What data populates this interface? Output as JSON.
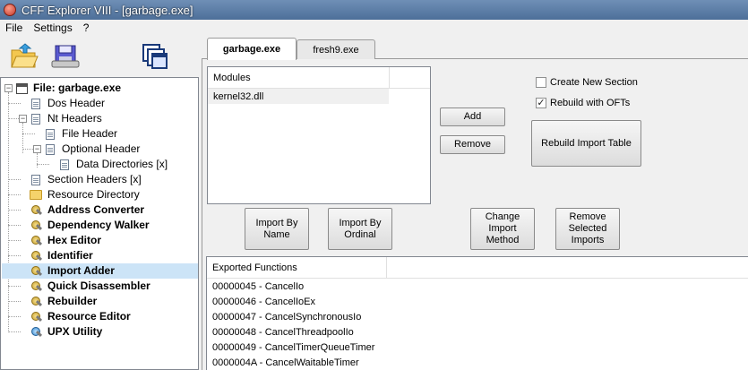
{
  "window": {
    "title": "CFF Explorer VIII - [garbage.exe]"
  },
  "menu": [
    "File",
    "Settings",
    "?"
  ],
  "toolbar": {
    "open_icon": "open-folder-icon",
    "save_icon": "save-disk-icon",
    "windows_icon": "windows-icon"
  },
  "tree": {
    "root": "File: garbage.exe",
    "items": [
      {
        "label": "Dos Header"
      },
      {
        "label": "Nt Headers"
      },
      {
        "label": "File Header"
      },
      {
        "label": "Optional Header"
      },
      {
        "label": "Data Directories [x]"
      },
      {
        "label": "Section Headers [x]"
      },
      {
        "label": "Resource Directory"
      },
      {
        "label": "Address Converter"
      },
      {
        "label": "Dependency Walker"
      },
      {
        "label": "Hex Editor"
      },
      {
        "label": "Identifier"
      },
      {
        "label": "Import Adder"
      },
      {
        "label": "Quick Disassembler"
      },
      {
        "label": "Rebuilder"
      },
      {
        "label": "Resource Editor"
      },
      {
        "label": "UPX Utility"
      }
    ],
    "selected": "Import Adder"
  },
  "tabs": [
    {
      "label": "garbage.exe",
      "active": true
    },
    {
      "label": "fresh9.exe",
      "active": false
    }
  ],
  "modules": {
    "header": "Modules",
    "rows": [
      "kernel32.dll"
    ]
  },
  "buttons": {
    "add": "Add",
    "remove": "Remove",
    "rebuild_import_table": "Rebuild Import Table",
    "import_by_name": "Import By Name",
    "import_by_ordinal": "Import By Ordinal",
    "change_import_method": "Change Import Method",
    "remove_selected_imports": "Remove Selected Imports"
  },
  "options": {
    "create_new_section": {
      "label": "Create New Section",
      "checked": false
    },
    "rebuild_with_ofts": {
      "label": "Rebuild with OFTs",
      "checked": true
    }
  },
  "exported_functions": {
    "header": "Exported Functions",
    "rows": [
      "00000045 - CancelIo",
      "00000046 - CancelIoEx",
      "00000047 - CancelSynchronousIo",
      "00000048 - CancelThreadpoolIo",
      "00000049 - CancelTimerQueueTimer",
      "0000004A - CancelWaitableTimer"
    ]
  }
}
